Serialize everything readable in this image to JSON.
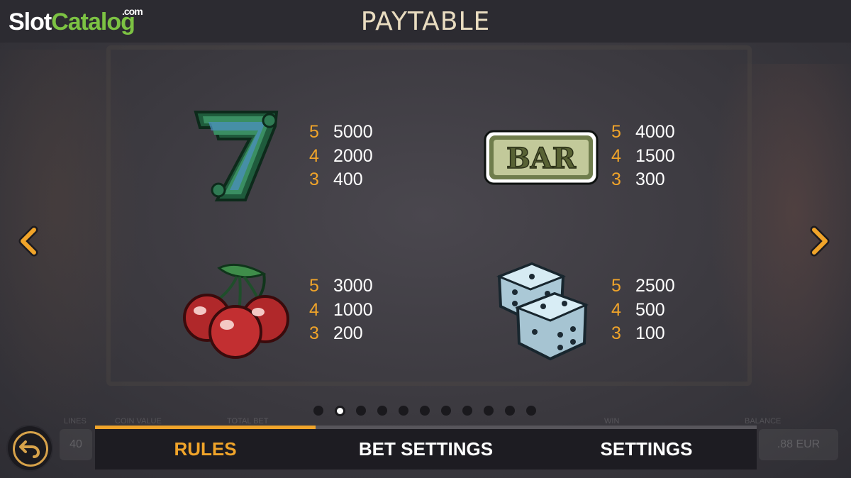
{
  "header": {
    "logo_slot": "Slot",
    "logo_catalog": "Catalog",
    "logo_com": ".com",
    "title": "PAYTABLE"
  },
  "paytable": [
    {
      "symbol": "seven-icon",
      "payouts": [
        {
          "count": "5",
          "value": "5000"
        },
        {
          "count": "4",
          "value": "2000"
        },
        {
          "count": "3",
          "value": "400"
        }
      ]
    },
    {
      "symbol": "bar-icon",
      "payouts": [
        {
          "count": "5",
          "value": "4000"
        },
        {
          "count": "4",
          "value": "1500"
        },
        {
          "count": "3",
          "value": "300"
        }
      ]
    },
    {
      "symbol": "cherries-icon",
      "payouts": [
        {
          "count": "5",
          "value": "3000"
        },
        {
          "count": "4",
          "value": "1000"
        },
        {
          "count": "3",
          "value": "200"
        }
      ]
    },
    {
      "symbol": "dice-icon",
      "payouts": [
        {
          "count": "5",
          "value": "2500"
        },
        {
          "count": "4",
          "value": "500"
        },
        {
          "count": "3",
          "value": "100"
        }
      ]
    }
  ],
  "bar_symbol_text": "BAR",
  "pagination": {
    "total": 11,
    "active": 1
  },
  "tabs": [
    {
      "label": "RULES",
      "active": true
    },
    {
      "label": "BET SETTINGS",
      "active": false
    },
    {
      "label": "SETTINGS",
      "active": false
    }
  ],
  "background_hud": {
    "lines_label": "LINES",
    "lines_value": "40",
    "coin_value_label": "COIN VALUE",
    "total_bet_label": "TOTAL BET",
    "win_label": "WIN",
    "balance_label": "BALANCE",
    "balance_value": ".88 EUR"
  },
  "colors": {
    "accent": "#f0a42a",
    "title": "#e9dcc0",
    "logo_green": "#7cc243",
    "tab_bg": "#1d1c22"
  },
  "icons": {
    "prev": "chevron-left-icon",
    "next": "chevron-right-icon",
    "back": "back-arrow-icon"
  }
}
